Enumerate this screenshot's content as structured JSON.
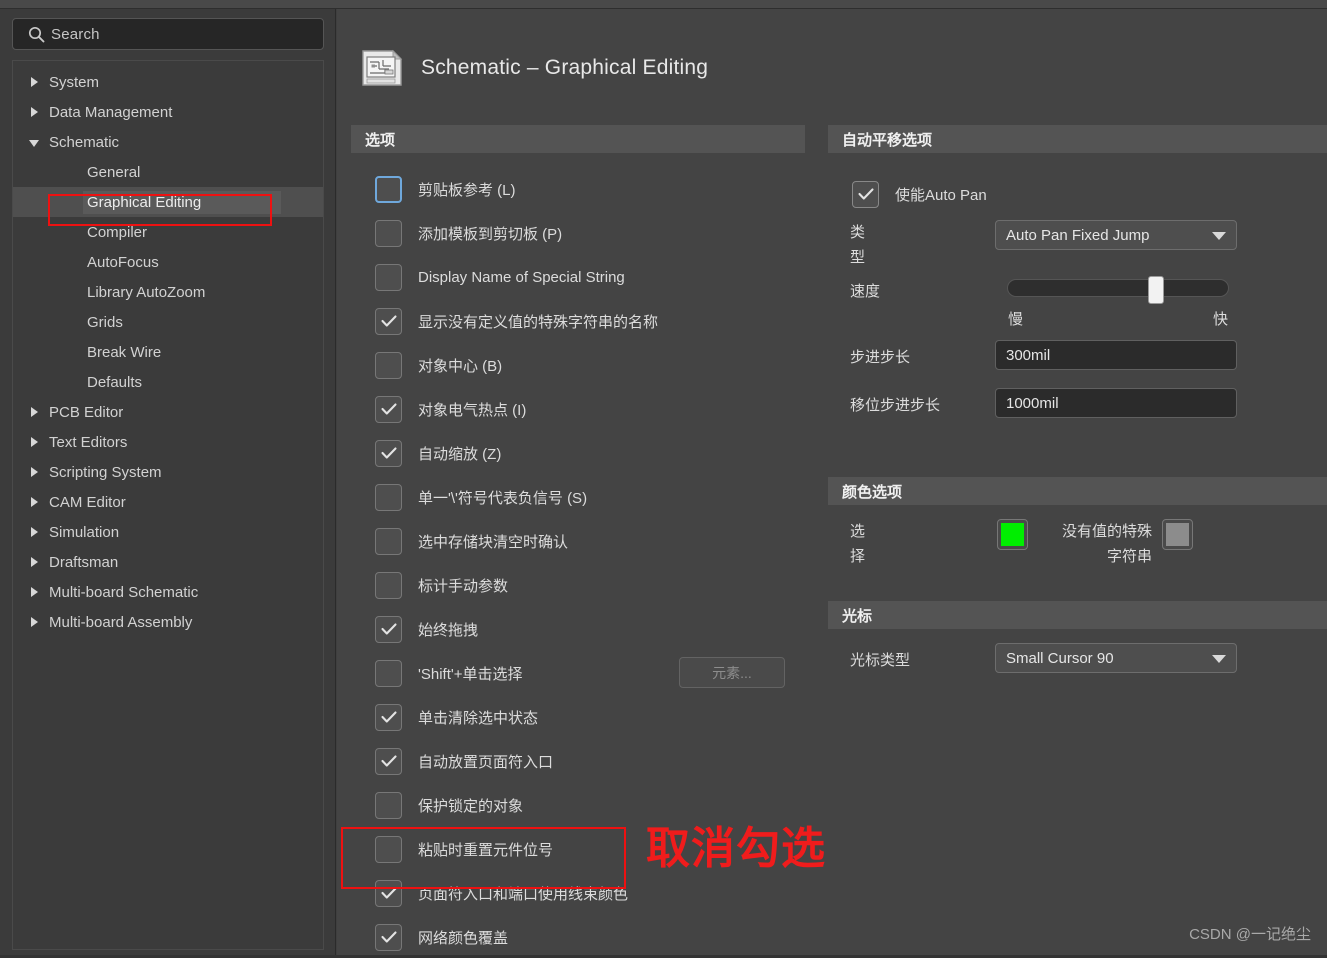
{
  "search": {
    "placeholder": "Search",
    "icon": "search-icon"
  },
  "sidebar": {
    "items": [
      {
        "label": "System",
        "level": 0,
        "expander": "right"
      },
      {
        "label": "Data Management",
        "level": 0,
        "expander": "right"
      },
      {
        "label": "Schematic",
        "level": 0,
        "expander": "down"
      },
      {
        "label": "General",
        "level": 1,
        "expander": "none"
      },
      {
        "label": "Graphical Editing",
        "level": 1,
        "expander": "none",
        "selected": true
      },
      {
        "label": "Compiler",
        "level": 1,
        "expander": "none"
      },
      {
        "label": "AutoFocus",
        "level": 1,
        "expander": "none"
      },
      {
        "label": "Library AutoZoom",
        "level": 1,
        "expander": "none"
      },
      {
        "label": "Grids",
        "level": 1,
        "expander": "none"
      },
      {
        "label": "Break Wire",
        "level": 1,
        "expander": "none"
      },
      {
        "label": "Defaults",
        "level": 1,
        "expander": "none"
      },
      {
        "label": "PCB Editor",
        "level": 0,
        "expander": "right"
      },
      {
        "label": "Text Editors",
        "level": 0,
        "expander": "right"
      },
      {
        "label": "Scripting System",
        "level": 0,
        "expander": "right"
      },
      {
        "label": "CAM Editor",
        "level": 0,
        "expander": "right"
      },
      {
        "label": "Simulation",
        "level": 0,
        "expander": "right"
      },
      {
        "label": "Draftsman",
        "level": 0,
        "expander": "right"
      },
      {
        "label": "Multi-board Schematic",
        "level": 0,
        "expander": "right"
      },
      {
        "label": "Multi-board Assembly",
        "level": 0,
        "expander": "right"
      }
    ]
  },
  "header": {
    "title": "Schematic – Graphical Editing",
    "icon": "schematic-document-icon"
  },
  "options_panel": {
    "title": "选项",
    "items": [
      {
        "label": "剪贴板参考 (L)",
        "checked": false,
        "focused": true
      },
      {
        "label": "添加模板到剪切板 (P)",
        "checked": false
      },
      {
        "label": "Display Name of Special String",
        "checked": false
      },
      {
        "label": "显示没有定义值的特殊字符串的名称",
        "checked": true
      },
      {
        "label": "对象中心 (B)",
        "checked": false
      },
      {
        "label": "对象电气热点 (I)",
        "checked": true
      },
      {
        "label": "自动缩放 (Z)",
        "checked": true
      },
      {
        "label": "单一'\\'符号代表负信号 (S)",
        "checked": false
      },
      {
        "label": "选中存储块清空时确认",
        "checked": false
      },
      {
        "label": "标计手动参数",
        "checked": false
      },
      {
        "label": "始终拖拽",
        "checked": true
      },
      {
        "label": "'Shift'+单击选择",
        "checked": false,
        "button": "元素..."
      },
      {
        "label": "单击清除选中状态",
        "checked": true
      },
      {
        "label": "自动放置页面符入口",
        "checked": true
      },
      {
        "label": "保护锁定的对象",
        "checked": false
      },
      {
        "label": "粘贴时重置元件位号",
        "checked": false
      },
      {
        "label": "页面符入口和端口使用线束颜色",
        "checked": true
      },
      {
        "label": "网络颜色覆盖",
        "checked": true
      }
    ]
  },
  "autopan_panel": {
    "title": "自动平移选项",
    "enable_label": "使能Auto Pan",
    "enable_checked": true,
    "type_label": "类型",
    "type_value": "Auto Pan Fixed Jump",
    "speed_label": "速度",
    "speed_min_label": "慢",
    "speed_max_label": "快",
    "speed_percent": 66,
    "step_label": "步进步长",
    "step_value": "300mil",
    "shift_step_label": "移位步进步长",
    "shift_step_value": "1000mil"
  },
  "color_panel": {
    "title": "颜色选项",
    "selection_label": "选择",
    "selection_color": "#00ee00",
    "novalue_label": "没有值的特殊字符串",
    "novalue_color": "#8c8c8c"
  },
  "cursor_panel": {
    "title": "光标",
    "type_label": "光标类型",
    "type_value": "Small Cursor 90"
  },
  "annotation": {
    "text": "取消勾选",
    "color": "#f01c1c"
  },
  "watermark": {
    "text": "CSDN @一记绝尘"
  }
}
